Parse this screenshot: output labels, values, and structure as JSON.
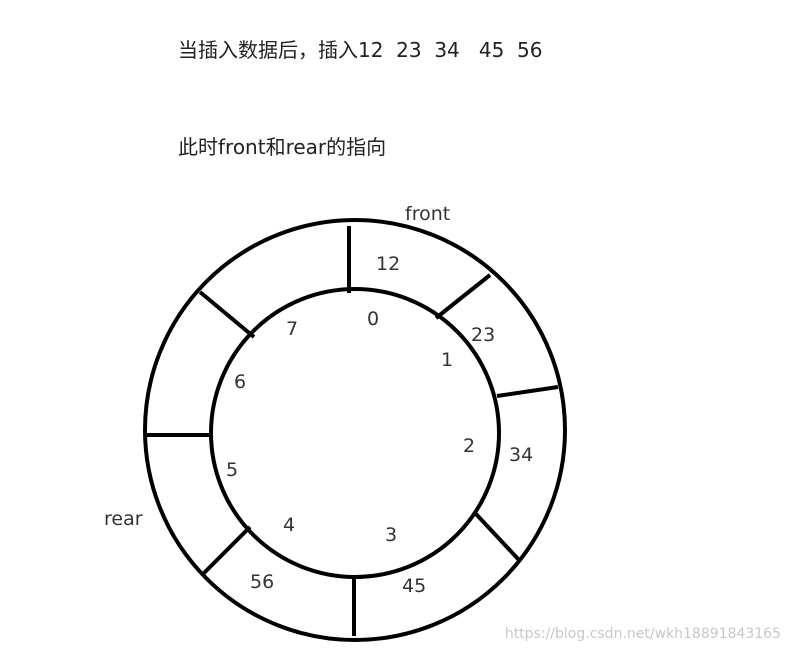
{
  "heading_line_1": "当插入数据后，插入12  23  34   45  56",
  "heading_line_2": "此时front和rear的指向",
  "pointers": {
    "front": "front",
    "rear": "rear"
  },
  "slots": [
    {
      "index": "0",
      "value": "12"
    },
    {
      "index": "1",
      "value": "23"
    },
    {
      "index": "2",
      "value": "34"
    },
    {
      "index": "3",
      "value": "45"
    },
    {
      "index": "4",
      "value": "56"
    },
    {
      "index": "5",
      "value": ""
    },
    {
      "index": "6",
      "value": ""
    },
    {
      "index": "7",
      "value": ""
    }
  ],
  "watermark": "https://blog.csdn.net/wkh18891843165",
  "colors": {
    "stroke": "#000000",
    "text": "#333333",
    "watermark": "#c8c8c8"
  }
}
